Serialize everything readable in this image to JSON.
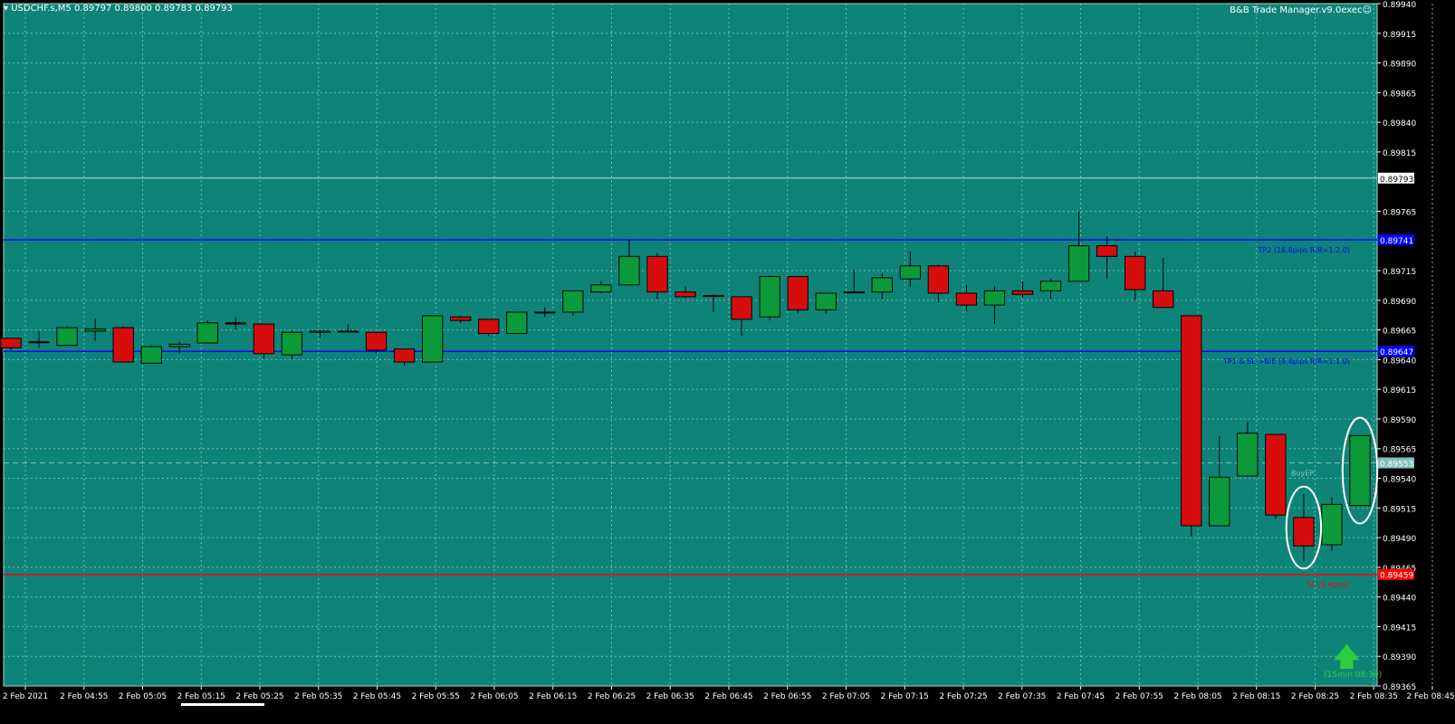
{
  "header": {
    "symbol_text": "▾ USDCHF.s,M5  0.89797 0.89800 0.89783 0.89793",
    "ea_text": "B&B Trade Manager.v9.0exec☺"
  },
  "colors": {
    "background": "#0e8479",
    "grid": "#6fb9b1",
    "bull": "#0a9a3a",
    "bear": "#d60d0d",
    "wick": "#000000",
    "tp_line": "#0000ff",
    "sl_line": "#ff0000",
    "entry_line": "#7fc2bb",
    "axis_text": "#000000",
    "annotation": "#ffffff"
  },
  "chart_data": {
    "type": "candlestick",
    "symbol": "USDCHF.s",
    "timeframe": "M5",
    "ylim": [
      0.89365,
      0.8994
    ],
    "y_ticks": [
      "0.89940",
      "0.89915",
      "0.89890",
      "0.89865",
      "0.89840",
      "0.89815",
      "0.89765",
      "0.89715",
      "0.89690",
      "0.89665",
      "0.89640",
      "0.89615",
      "0.89590",
      "0.89565",
      "0.89540",
      "0.89515",
      "0.89490",
      "0.89465",
      "0.89440",
      "0.89415",
      "0.89390",
      "0.89365"
    ],
    "x_ticks": [
      "2 Feb 2021",
      "2 Feb 04:55",
      "2 Feb 05:05",
      "2 Feb 05:15",
      "2 Feb 05:25",
      "2 Feb 05:35",
      "2 Feb 05:45",
      "2 Feb 05:55",
      "2 Feb 06:05",
      "2 Feb 06:15",
      "2 Feb 06:25",
      "2 Feb 06:35",
      "2 Feb 06:45",
      "2 Feb 06:55",
      "2 Feb 07:05",
      "2 Feb 07:15",
      "2 Feb 07:25",
      "2 Feb 07:35",
      "2 Feb 07:45",
      "2 Feb 07:55",
      "2 Feb 08:05",
      "2 Feb 08:15",
      "2 Feb 08:25",
      "2 Feb 08:35",
      "2 Feb 08:45"
    ],
    "candles": [
      {
        "o": 0.89658,
        "h": 0.89658,
        "l": 0.89648,
        "c": 0.8965
      },
      {
        "o": 0.89655,
        "h": 0.89664,
        "l": 0.8965,
        "c": 0.89655
      },
      {
        "o": 0.89652,
        "h": 0.89668,
        "l": 0.89652,
        "c": 0.89667
      },
      {
        "o": 0.89664,
        "h": 0.89675,
        "l": 0.89656,
        "c": 0.89666
      },
      {
        "o": 0.89667,
        "h": 0.89668,
        "l": 0.89638,
        "c": 0.89638
      },
      {
        "o": 0.89637,
        "h": 0.89652,
        "l": 0.89637,
        "c": 0.89651
      },
      {
        "o": 0.89651,
        "h": 0.89655,
        "l": 0.89645,
        "c": 0.89653
      },
      {
        "o": 0.89654,
        "h": 0.89673,
        "l": 0.89654,
        "c": 0.89671
      },
      {
        "o": 0.89671,
        "h": 0.89676,
        "l": 0.89665,
        "c": 0.8967
      },
      {
        "o": 0.8967,
        "h": 0.8967,
        "l": 0.89641,
        "c": 0.89645
      },
      {
        "o": 0.89644,
        "h": 0.89664,
        "l": 0.8964,
        "c": 0.89663
      },
      {
        "o": 0.89663,
        "h": 0.89665,
        "l": 0.89658,
        "c": 0.89664
      },
      {
        "o": 0.89664,
        "h": 0.8967,
        "l": 0.89663,
        "c": 0.89664
      },
      {
        "o": 0.89663,
        "h": 0.89664,
        "l": 0.89645,
        "c": 0.89648
      },
      {
        "o": 0.89649,
        "h": 0.89649,
        "l": 0.89635,
        "c": 0.89638
      },
      {
        "o": 0.89638,
        "h": 0.89677,
        "l": 0.89638,
        "c": 0.89677
      },
      {
        "o": 0.89676,
        "h": 0.89677,
        "l": 0.89671,
        "c": 0.89673
      },
      {
        "o": 0.89674,
        "h": 0.89674,
        "l": 0.8966,
        "c": 0.89662
      },
      {
        "o": 0.89662,
        "h": 0.8968,
        "l": 0.89662,
        "c": 0.8968
      },
      {
        "o": 0.8968,
        "h": 0.89684,
        "l": 0.89676,
        "c": 0.8968
      },
      {
        "o": 0.8968,
        "h": 0.89698,
        "l": 0.89677,
        "c": 0.89698
      },
      {
        "o": 0.89697,
        "h": 0.89706,
        "l": 0.89696,
        "c": 0.89703
      },
      {
        "o": 0.89703,
        "h": 0.89741,
        "l": 0.89703,
        "c": 0.89727
      },
      {
        "o": 0.89727,
        "h": 0.8973,
        "l": 0.89691,
        "c": 0.89697
      },
      {
        "o": 0.89697,
        "h": 0.89702,
        "l": 0.89692,
        "c": 0.89693
      },
      {
        "o": 0.89694,
        "h": 0.89695,
        "l": 0.8968,
        "c": 0.89694
      },
      {
        "o": 0.89693,
        "h": 0.89693,
        "l": 0.8966,
        "c": 0.89674
      },
      {
        "o": 0.89676,
        "h": 0.89711,
        "l": 0.89673,
        "c": 0.8971
      },
      {
        "o": 0.8971,
        "h": 0.8971,
        "l": 0.89679,
        "c": 0.89682
      },
      {
        "o": 0.89682,
        "h": 0.89696,
        "l": 0.89679,
        "c": 0.89696
      },
      {
        "o": 0.89697,
        "h": 0.89716,
        "l": 0.89697,
        "c": 0.89697
      },
      {
        "o": 0.89697,
        "h": 0.89713,
        "l": 0.89691,
        "c": 0.89709
      },
      {
        "o": 0.89708,
        "h": 0.89731,
        "l": 0.89701,
        "c": 0.89719
      },
      {
        "o": 0.89719,
        "h": 0.8972,
        "l": 0.89688,
        "c": 0.89696
      },
      {
        "o": 0.89696,
        "h": 0.89703,
        "l": 0.89681,
        "c": 0.89686
      },
      {
        "o": 0.89686,
        "h": 0.89702,
        "l": 0.8967,
        "c": 0.89698
      },
      {
        "o": 0.89698,
        "h": 0.89706,
        "l": 0.89692,
        "c": 0.89695
      },
      {
        "o": 0.89698,
        "h": 0.89708,
        "l": 0.89691,
        "c": 0.89706
      },
      {
        "o": 0.89706,
        "h": 0.89765,
        "l": 0.89706,
        "c": 0.89736
      },
      {
        "o": 0.89736,
        "h": 0.89744,
        "l": 0.89708,
        "c": 0.89727
      },
      {
        "o": 0.89727,
        "h": 0.89731,
        "l": 0.8969,
        "c": 0.89699
      },
      {
        "o": 0.89698,
        "h": 0.89726,
        "l": 0.89684,
        "c": 0.89684
      },
      {
        "o": 0.89677,
        "h": 0.89677,
        "l": 0.89491,
        "c": 0.895
      },
      {
        "o": 0.895,
        "h": 0.89576,
        "l": 0.895,
        "c": 0.89541
      },
      {
        "o": 0.89542,
        "h": 0.89588,
        "l": 0.89542,
        "c": 0.89578
      },
      {
        "o": 0.89577,
        "h": 0.89577,
        "l": 0.89506,
        "c": 0.89509
      },
      {
        "o": 0.89507,
        "h": 0.89527,
        "l": 0.8947,
        "c": 0.89483
      },
      {
        "o": 0.89484,
        "h": 0.89524,
        "l": 0.89479,
        "c": 0.89518
      },
      {
        "o": 0.89517,
        "h": 0.89576,
        "l": 0.89517,
        "c": 0.89576
      }
    ],
    "levels": [
      {
        "name": "tp2",
        "price": 0.89741,
        "label": "TP2 (18.8pips R/R=1:2.0)",
        "tag": "0.89741"
      },
      {
        "name": "tp1",
        "price": 0.89647,
        "label": "TP1 & SL->B/E (9.4pips R/R=1:1.0)",
        "tag": "0.89647"
      },
      {
        "name": "entry",
        "price": 0.89553,
        "label": "BuyEP",
        "tag": "0.89553"
      },
      {
        "name": "sl",
        "price": 0.89459,
        "label": "SL (9.4pips)",
        "tag": "0.89459"
      }
    ],
    "current_price": {
      "value": 0.89793,
      "tag": "0.89793"
    },
    "buy_signal": {
      "arrow": "🡅",
      "text": "(15min 08:30)"
    }
  }
}
